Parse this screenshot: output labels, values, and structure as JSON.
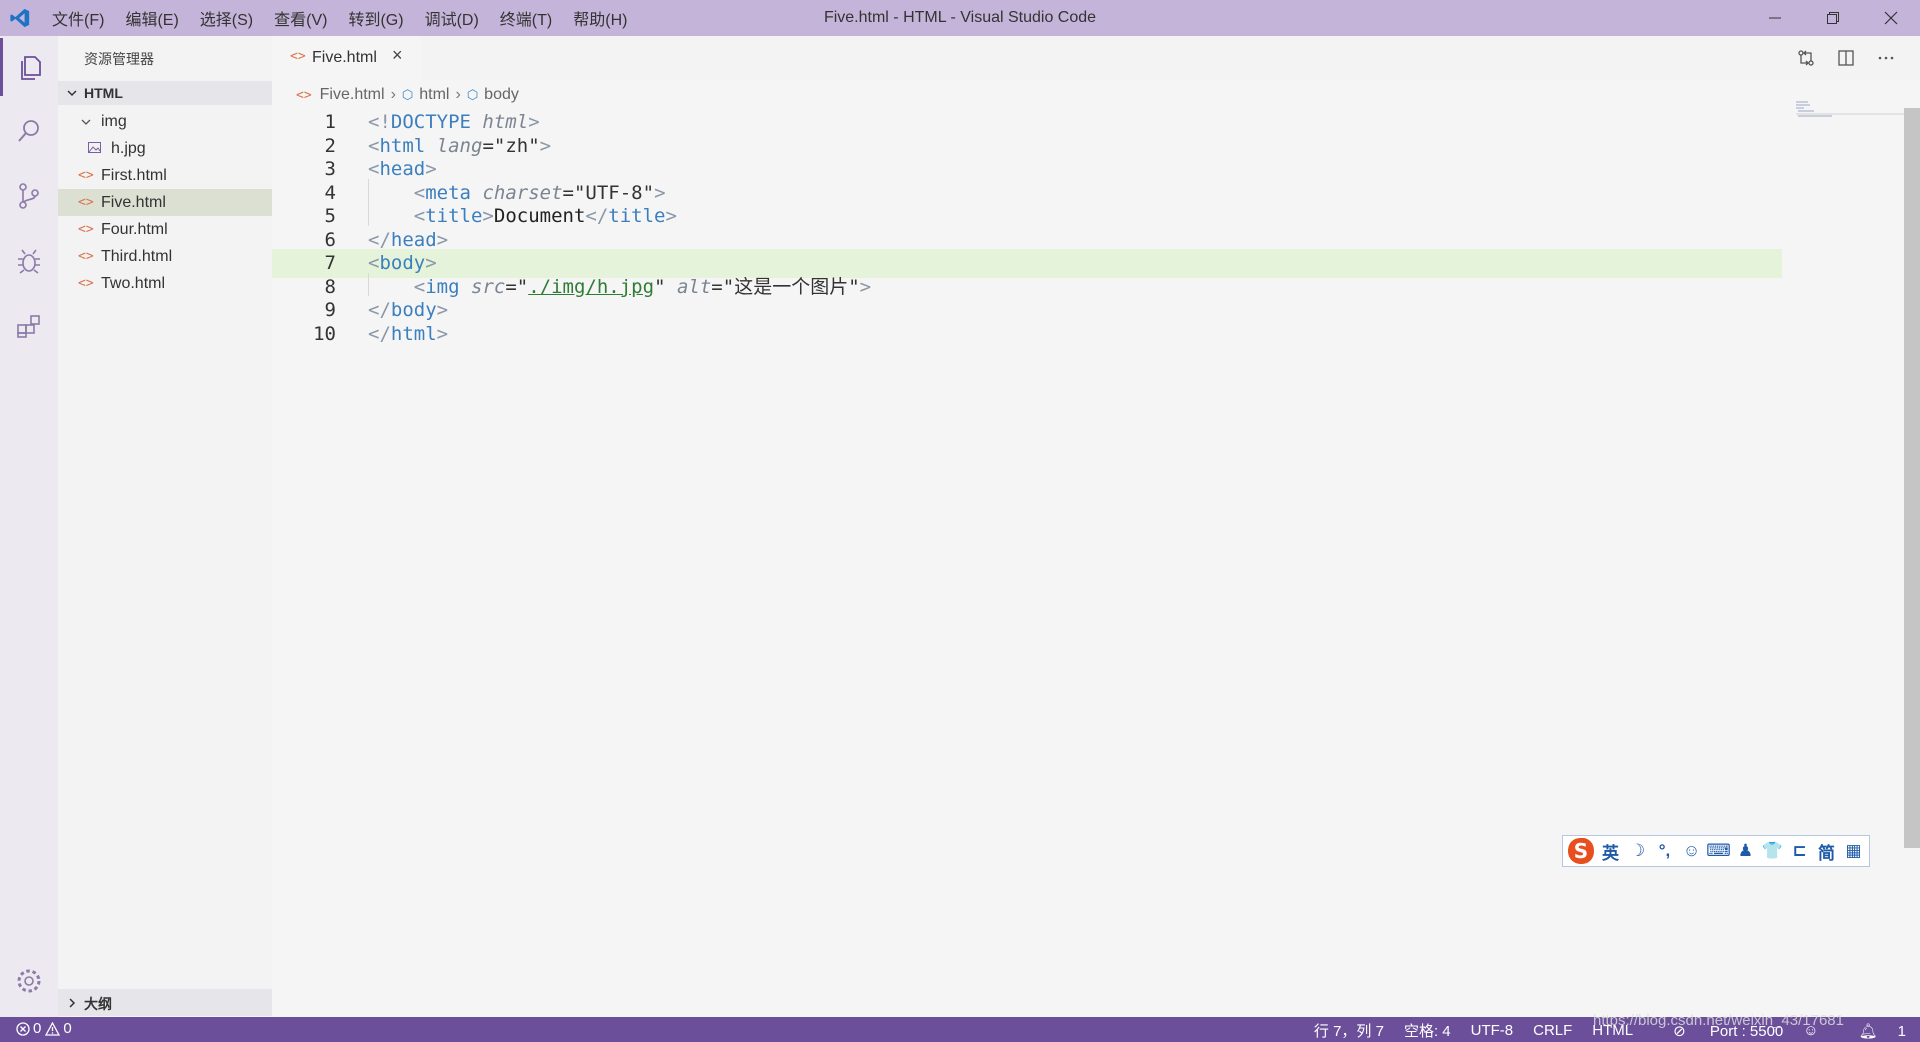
{
  "window": {
    "title": "Five.html - HTML - Visual Studio Code",
    "menu": [
      "文件(F)",
      "编辑(E)",
      "选择(S)",
      "查看(V)",
      "转到(G)",
      "调试(D)",
      "终端(T)",
      "帮助(H)"
    ]
  },
  "colors": {
    "titlebar": "#c5b4d9",
    "statusbar": "#6c4f9a",
    "current_line": "#e4f3d9",
    "selected_file": "#dbe0d2"
  },
  "sidebar": {
    "title": "资源管理器",
    "folder": "HTML",
    "items": [
      {
        "label": "img",
        "type": "folder"
      },
      {
        "label": "h.jpg",
        "type": "image"
      },
      {
        "label": "First.html",
        "type": "html"
      },
      {
        "label": "Five.html",
        "type": "html",
        "selected": true
      },
      {
        "label": "Four.html",
        "type": "html"
      },
      {
        "label": "Third.html",
        "type": "html"
      },
      {
        "label": "Two.html",
        "type": "html"
      }
    ],
    "outline": "大纲"
  },
  "editor": {
    "tab": "Five.html",
    "breadcrumb": [
      "Five.html",
      "html",
      "body"
    ],
    "current_line": 7,
    "lines": [
      "<!DOCTYPE html>",
      "<html lang=\"zh\">",
      "<head>",
      "    <meta charset=\"UTF-8\">",
      "    <title>Document</title>",
      "</head>",
      "<body>",
      "    <img src=\"./img/h.jpg\" alt=\"这是一个图片\">",
      "</body>",
      "</html>"
    ]
  },
  "ime": {
    "icon": "sogou-icon",
    "glyphs": [
      "英",
      "☽",
      "°,",
      "☺",
      "⌨",
      "♟",
      "👕",
      "⊏",
      "简",
      "▦"
    ]
  },
  "statusbar": {
    "errors": "0",
    "warnings": "0",
    "position": "行 7，列 7",
    "indent": "空格: 4",
    "encoding": "UTF-8",
    "eol": "CRLF",
    "language": "HTML",
    "port": "Port : 5500",
    "notifications": "1"
  },
  "watermark": "https://blog.csdn.net/weixin_43/17681"
}
